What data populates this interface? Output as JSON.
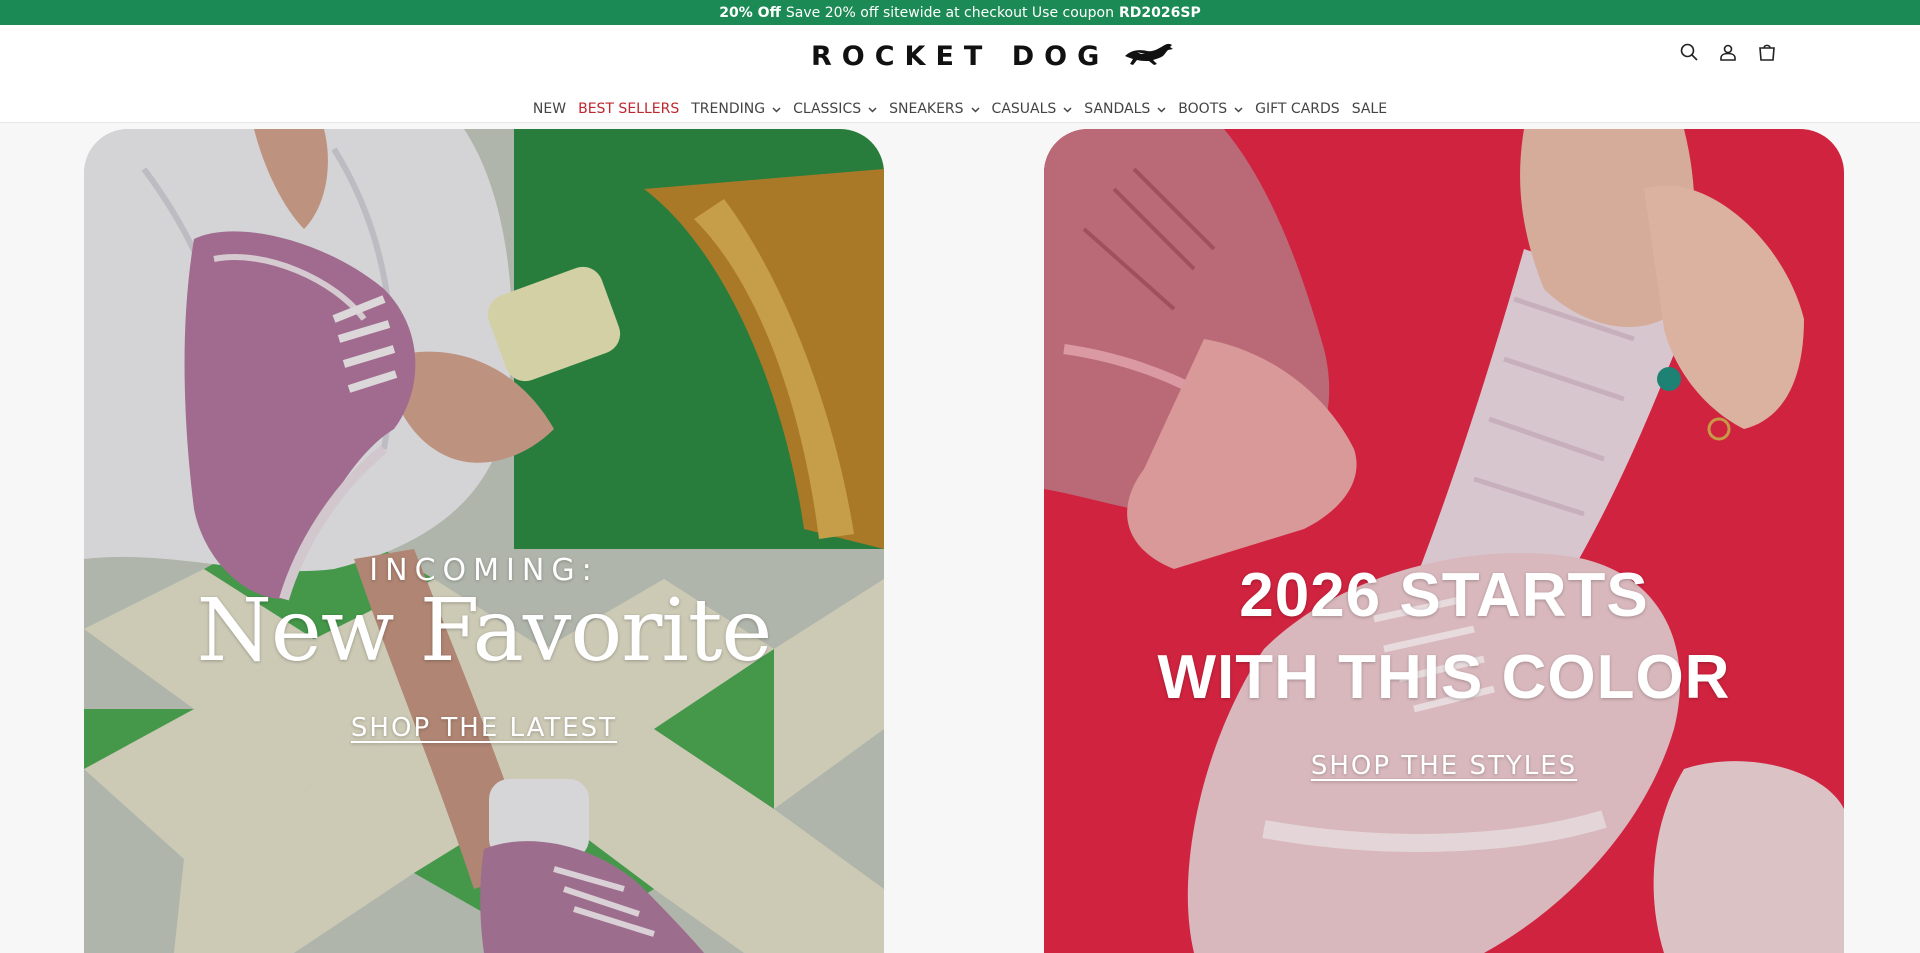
{
  "announcement": {
    "bold_lead": "20% Off",
    "text": "Save 20% off sitewide at checkout Use coupon",
    "coupon": "RD2026SP",
    "bg_color": "#1b8a55"
  },
  "header": {
    "logo_text": "ROCKET DOG",
    "logo_icon": "running-dog-icon",
    "icons": [
      "search-icon",
      "account-icon",
      "cart-icon"
    ]
  },
  "nav": {
    "items": [
      {
        "label": "NEW",
        "dropdown": false
      },
      {
        "label": "BEST SELLERS",
        "dropdown": false,
        "color": "#c0262d"
      },
      {
        "label": "TRENDING",
        "dropdown": true
      },
      {
        "label": "CLASSICS",
        "dropdown": true
      },
      {
        "label": "SNEAKERS",
        "dropdown": true
      },
      {
        "label": "CASUALS",
        "dropdown": true
      },
      {
        "label": "SANDALS",
        "dropdown": true
      },
      {
        "label": "BOOTS",
        "dropdown": true
      },
      {
        "label": "GIFT CARDS",
        "dropdown": false
      },
      {
        "label": "SALE",
        "dropdown": false
      }
    ]
  },
  "hero_left": {
    "eyebrow": "INCOMING:",
    "headline": "New Favorite",
    "cta": "SHOP THE LATEST"
  },
  "hero_right": {
    "headline_line1": "2026 STARTS",
    "headline_line2": "WITH THIS COLOR",
    "cta": "SHOP THE STYLES"
  }
}
